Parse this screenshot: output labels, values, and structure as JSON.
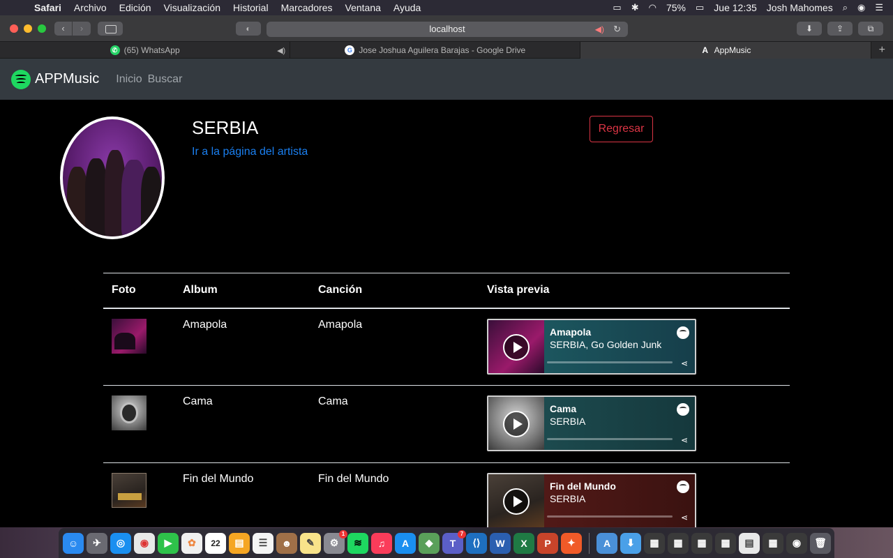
{
  "menubar": {
    "app": "Safari",
    "items": [
      "Archivo",
      "Edición",
      "Visualización",
      "Historial",
      "Marcadores",
      "Ventana",
      "Ayuda"
    ],
    "battery": "75%",
    "clock": "Jue 12:35",
    "user": "Josh Mahomes"
  },
  "browser": {
    "url": "localhost",
    "tabs": [
      {
        "title": "(65) WhatsApp",
        "icon": "whatsapp-icon"
      },
      {
        "title": "Jose Joshua Aguilera Barajas - Google Drive",
        "icon": "google-icon"
      },
      {
        "title": "AppMusic",
        "icon": "angular-icon"
      }
    ]
  },
  "navbar": {
    "brand": "APPMusic",
    "links": [
      "Inicio",
      "Buscar"
    ]
  },
  "artist": {
    "name": "SERBIA",
    "link_text": "Ir a la página del artista",
    "back_label": "Regresar"
  },
  "table": {
    "headers": [
      "Foto",
      "Album",
      "Canción",
      "Vista previa"
    ],
    "rows": [
      {
        "album": "Amapola",
        "song": "Amapola",
        "preview_title": "Amapola",
        "preview_artists": "SERBIA, Go Golden Junk",
        "embed_color": "#1e5f66"
      },
      {
        "album": "Cama",
        "song": "Cama",
        "preview_title": "Cama",
        "preview_artists": "SERBIA",
        "embed_color": "#1f5155"
      },
      {
        "album": "Fin del Mundo",
        "song": "Fin del Mundo",
        "preview_title": "Fin del Mundo",
        "preview_artists": "SERBIA",
        "embed_color": "#5a1c1a"
      }
    ]
  },
  "dock": {
    "calendar_day": "22",
    "badges": {
      "system_prefs": "1",
      "teams": "7"
    }
  }
}
